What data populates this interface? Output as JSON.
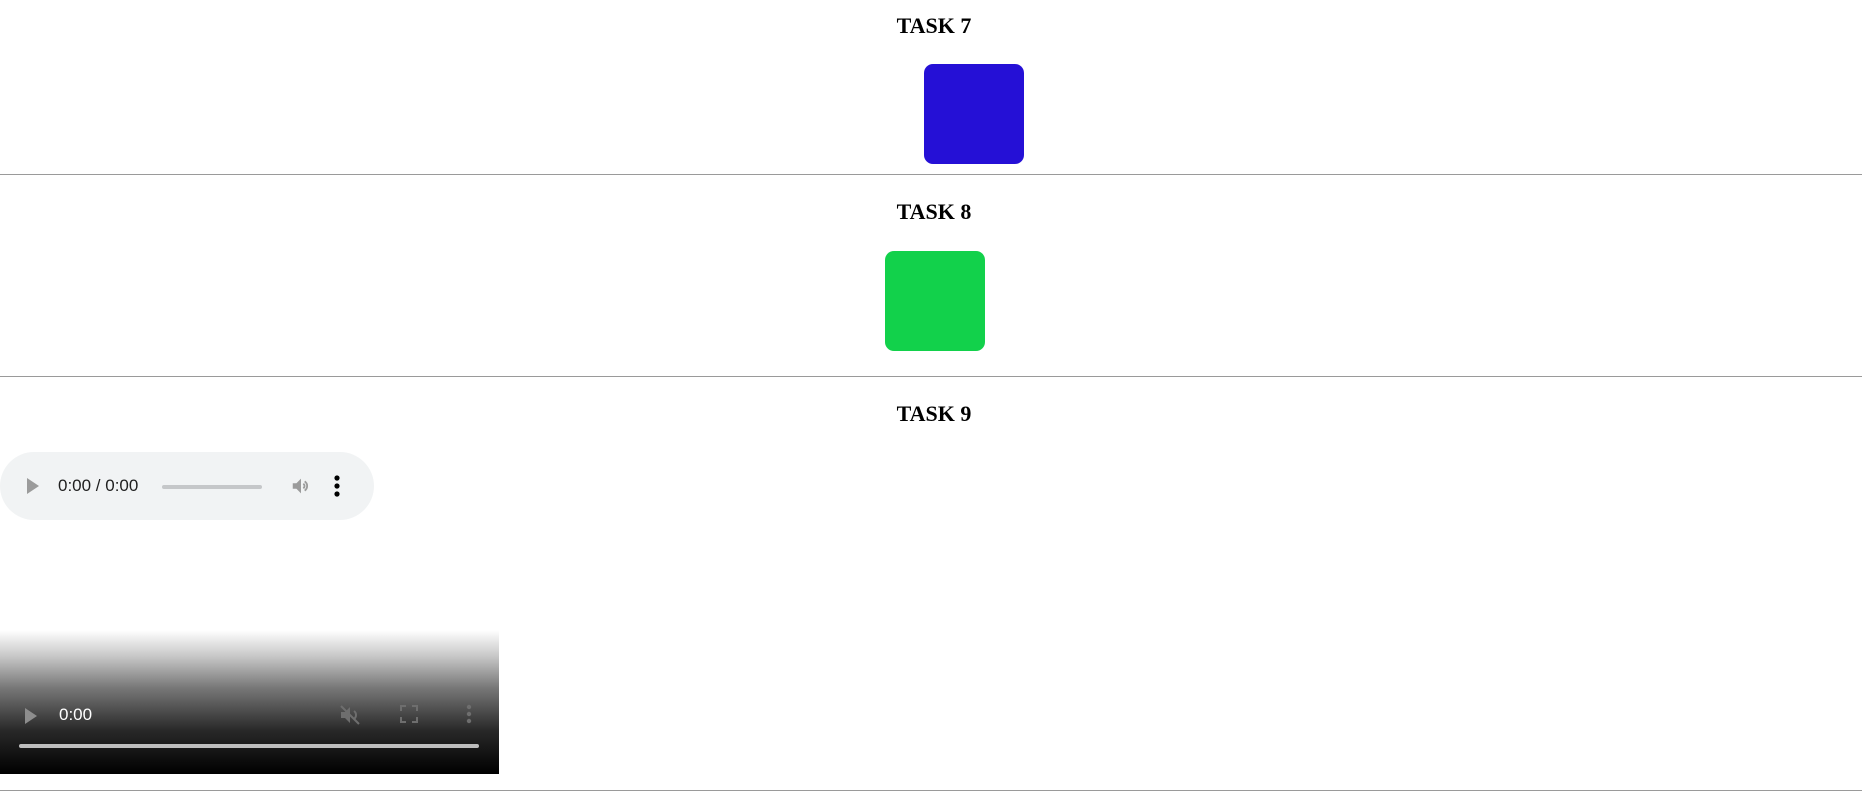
{
  "tasks": [
    {
      "title": "TASK 7",
      "box_color": "#2510d6"
    },
    {
      "title": "TASK 8",
      "box_color": "#12d14b"
    },
    {
      "title": "TASK 9"
    }
  ],
  "audio_player": {
    "time": "0:00 / 0:00",
    "play_icon": "play-icon",
    "volume_icon": "volume-icon",
    "menu_icon": "more-vertical-icon"
  },
  "video_player": {
    "time": "0:00",
    "play_icon": "play-icon",
    "mute_icon": "muted-icon",
    "fullscreen_icon": "fullscreen-icon",
    "menu_icon": "more-vertical-icon"
  }
}
